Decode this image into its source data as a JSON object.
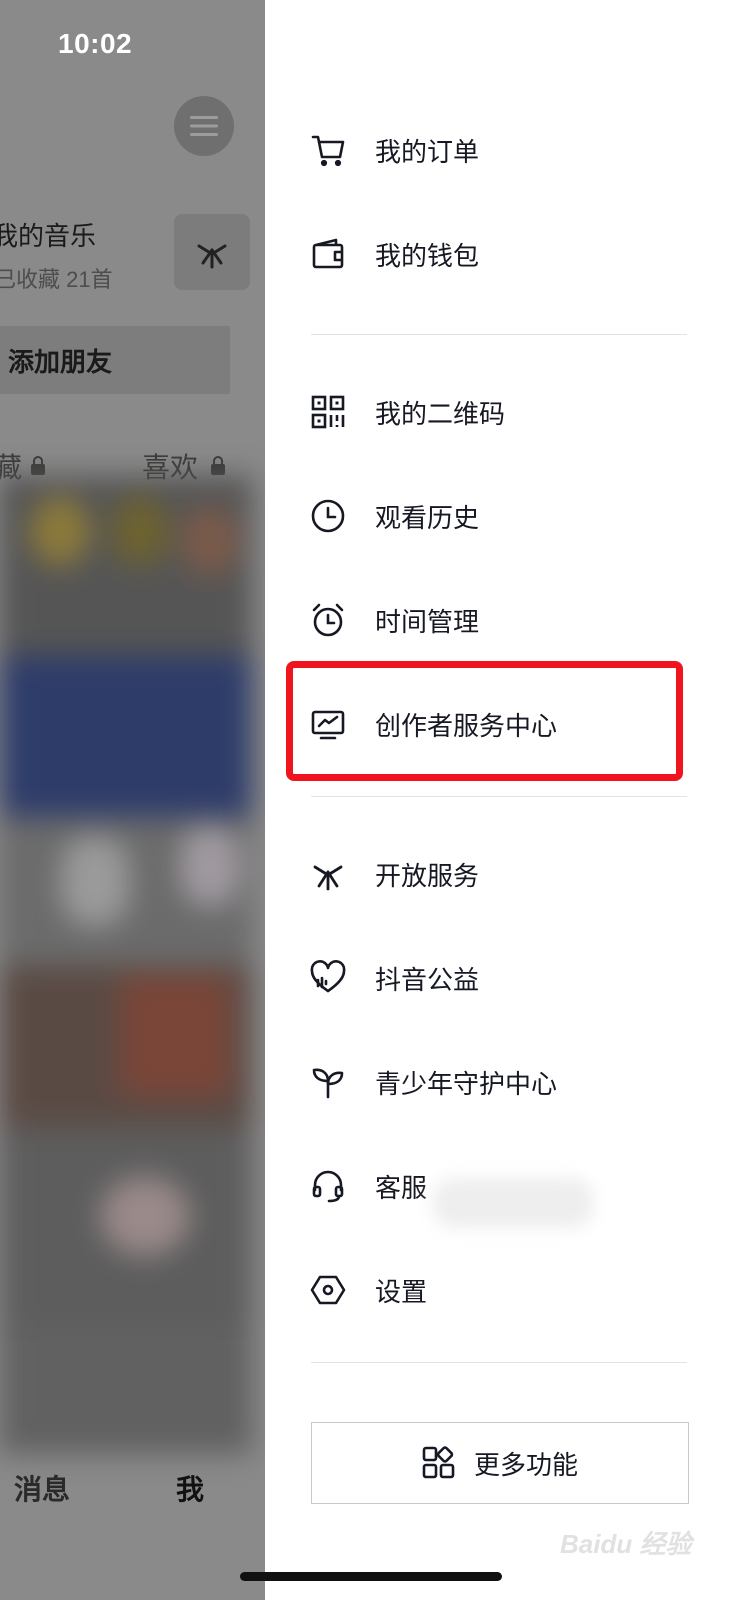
{
  "status_bar": {
    "time": "10:02"
  },
  "profile": {
    "music_title": "我的音乐",
    "music_sub": "已收藏 21首",
    "add_friend": "添加朋友",
    "tab_favorites": "藏",
    "tab_likes": "喜欢"
  },
  "bottom_nav": {
    "messages": "消息",
    "me": "我"
  },
  "drawer": {
    "items": [
      {
        "label": "我的订单",
        "icon": "cart-icon"
      },
      {
        "label": "我的钱包",
        "icon": "wallet-icon"
      },
      {
        "label": "我的二维码",
        "icon": "qr-code-icon"
      },
      {
        "label": "观看历史",
        "icon": "clock-icon"
      },
      {
        "label": "时间管理",
        "icon": "alarm-clock-icon"
      },
      {
        "label": "创作者服务中心",
        "icon": "creator-chart-icon"
      },
      {
        "label": "开放服务",
        "icon": "asterisk-icon"
      },
      {
        "label": "抖音公益",
        "icon": "heart-icon"
      },
      {
        "label": "青少年守护中心",
        "icon": "sprout-icon"
      },
      {
        "label": "客服",
        "icon": "headset-icon"
      },
      {
        "label": "设置",
        "icon": "hexagon-settings-icon"
      }
    ],
    "more_button": "更多功能"
  },
  "highlight_color": "#f0141e",
  "watermark": "Baidu 经验"
}
